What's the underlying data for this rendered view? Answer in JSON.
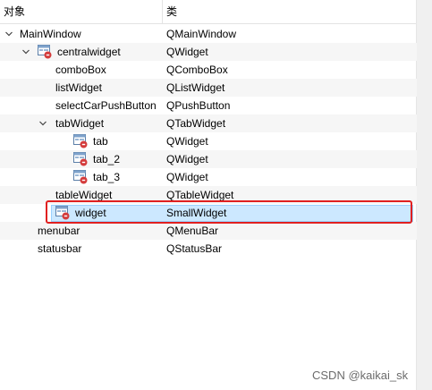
{
  "header": {
    "col_object": "对象",
    "col_class": "类"
  },
  "tree": [
    {
      "name": "MainWindow",
      "class": "QMainWindow",
      "expandable": true,
      "icon": false
    },
    {
      "name": "centralwidget",
      "class": "QWidget",
      "expandable": true,
      "icon": true
    },
    {
      "name": "comboBox",
      "class": "QComboBox",
      "expandable": false,
      "icon": false
    },
    {
      "name": "listWidget",
      "class": "QListWidget",
      "expandable": false,
      "icon": false
    },
    {
      "name": "selectCarPushButton",
      "class": "QPushButton",
      "expandable": false,
      "icon": false
    },
    {
      "name": "tabWidget",
      "class": "QTabWidget",
      "expandable": true,
      "icon": false
    },
    {
      "name": "tab",
      "class": "QWidget",
      "expandable": false,
      "icon": true
    },
    {
      "name": "tab_2",
      "class": "QWidget",
      "expandable": false,
      "icon": true
    },
    {
      "name": "tab_3",
      "class": "QWidget",
      "expandable": false,
      "icon": true
    },
    {
      "name": "tableWidget",
      "class": "QTableWidget",
      "expandable": false,
      "icon": false
    },
    {
      "name": "widget",
      "class": "SmallWidget",
      "expandable": false,
      "icon": true,
      "selected": true
    },
    {
      "name": "menubar",
      "class": "QMenuBar",
      "expandable": false,
      "icon": false
    },
    {
      "name": "statusbar",
      "class": "QStatusBar",
      "expandable": false,
      "icon": false
    }
  ],
  "icons": {
    "widget_icon": "widget-icon",
    "expand_arrow": "chevron-down-icon"
  },
  "colors": {
    "selection": "#cce8ff",
    "highlight_border": "#e02020"
  },
  "watermark": "CSDN @kaikai_sk"
}
